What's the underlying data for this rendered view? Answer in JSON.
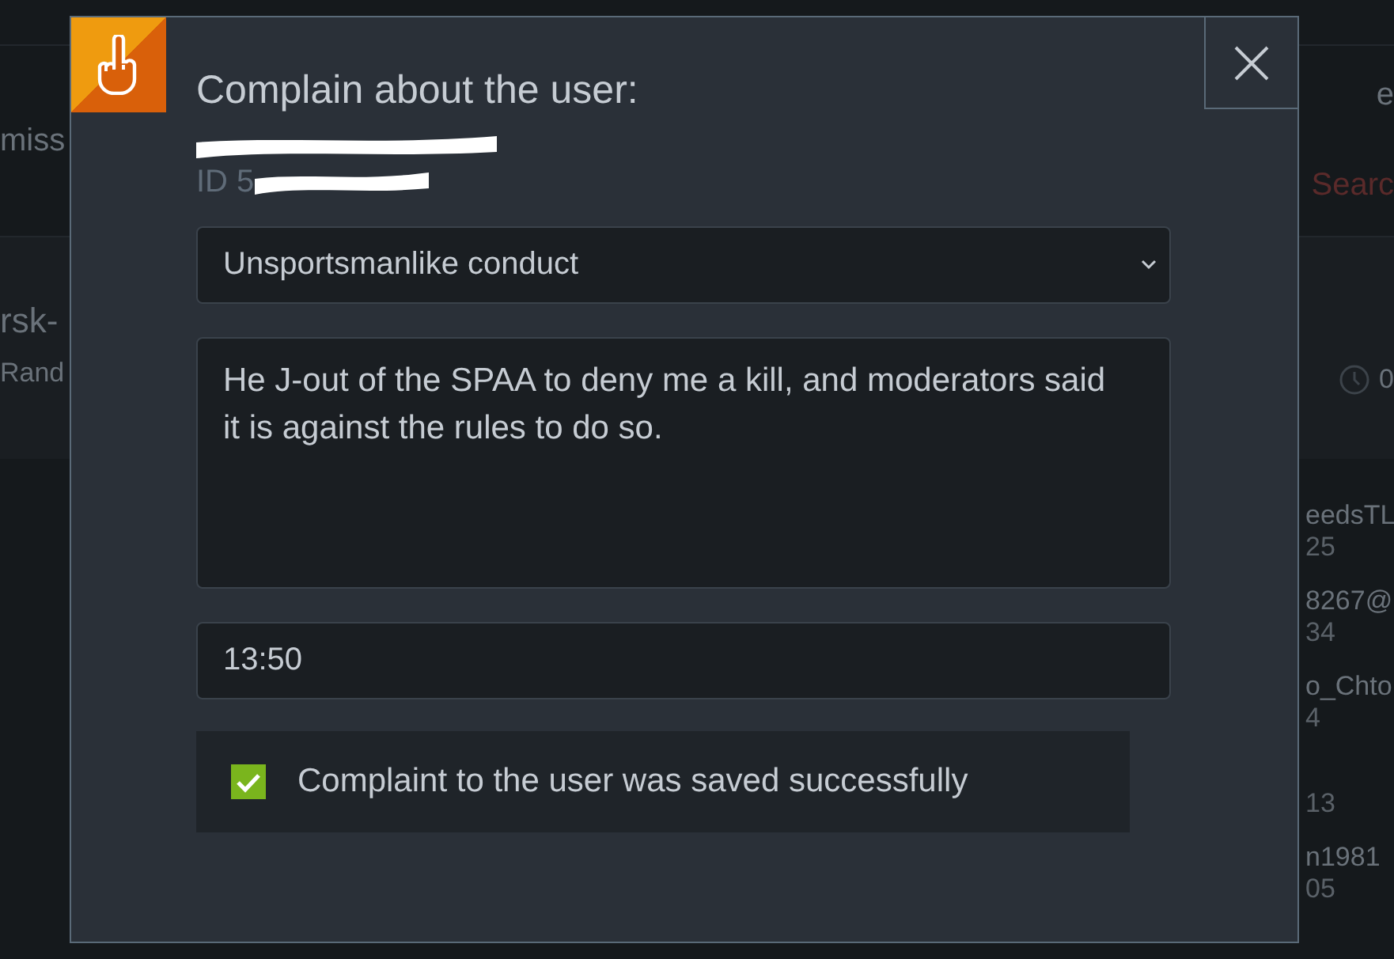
{
  "background": {
    "left_texts": [
      "miss",
      "rsk-",
      "Rand"
    ],
    "right_top": [
      "e",
      "Searc"
    ],
    "clock_text": "0",
    "right_list": [
      {
        "name": "eedsTL",
        "sub": "25"
      },
      {
        "name": "8267@",
        "sub": "34"
      },
      {
        "name": "o_Chto",
        "sub": "4"
      },
      {
        "sub": "13"
      },
      {
        "name": "n1981",
        "sub": "05"
      }
    ]
  },
  "dialog": {
    "title": "Complain about the user:",
    "user_id_prefix": "ID 5",
    "reason": {
      "value": "Unsportsmanlike conduct"
    },
    "comment": {
      "value": "He J-out of the SPAA to deny me a kill, and moderators said it is against the rules to do so."
    },
    "time": {
      "value": "13:50"
    },
    "status": {
      "checked": true,
      "message": "Complaint to the user was saved successfully"
    }
  }
}
